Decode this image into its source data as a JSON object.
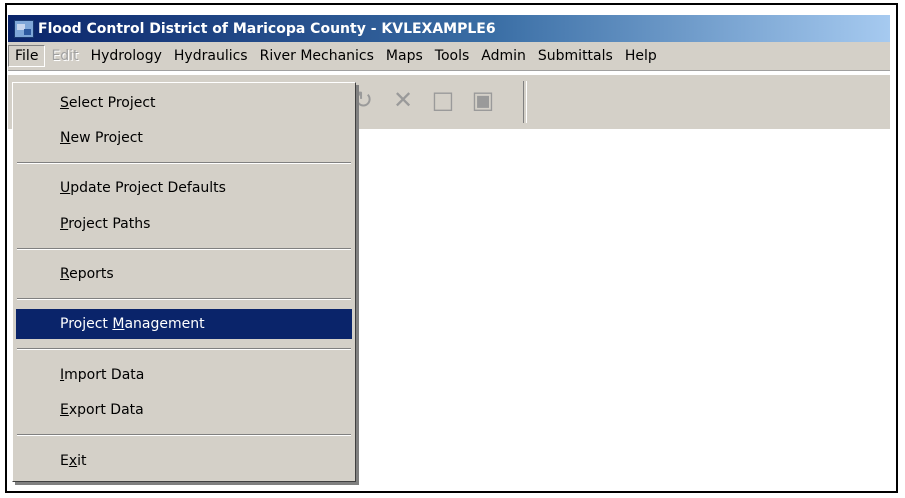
{
  "window": {
    "title": "Flood Control District of Maricopa County - KVLEXAMPLE6",
    "icon": "app-icon"
  },
  "menubar": {
    "items": [
      {
        "label": "File",
        "state": "active"
      },
      {
        "label": "Edit",
        "state": "disabled"
      },
      {
        "label": "Hydrology"
      },
      {
        "label": "Hydraulics"
      },
      {
        "label": "River Mechanics"
      },
      {
        "label": "Maps"
      },
      {
        "label": "Tools"
      },
      {
        "label": "Admin"
      },
      {
        "label": "Submittals"
      },
      {
        "label": "Help"
      }
    ]
  },
  "file_menu": {
    "items": [
      {
        "label": "Select Project",
        "mnemonic": "S",
        "rest": "elect Project"
      },
      {
        "label": "New Project",
        "mnemonic": "N",
        "rest": "ew Project"
      },
      {
        "label": "Update Project Defaults",
        "mnemonic": "U",
        "rest": "pdate Project Defaults"
      },
      {
        "label": "Project Paths",
        "mnemonic": "P",
        "rest": "roject Paths"
      },
      {
        "label": "Reports",
        "mnemonic": "R",
        "rest": "eports"
      },
      {
        "label": "Project Management",
        "pre": "Project ",
        "mnemonic": "M",
        "rest": "anagement",
        "highlighted": true
      },
      {
        "label": "Import Data",
        "mnemonic": "I",
        "rest": "mport Data"
      },
      {
        "label": "Export Data",
        "mnemonic": "E",
        "rest": "xport Data"
      },
      {
        "label": "Exit",
        "pre": "E",
        "mnemonic": "x",
        "rest": "it"
      }
    ]
  },
  "toolbar": {
    "icons": [
      "refresh-icon",
      "delete-icon",
      "new-document-icon",
      "camera-icon"
    ]
  }
}
